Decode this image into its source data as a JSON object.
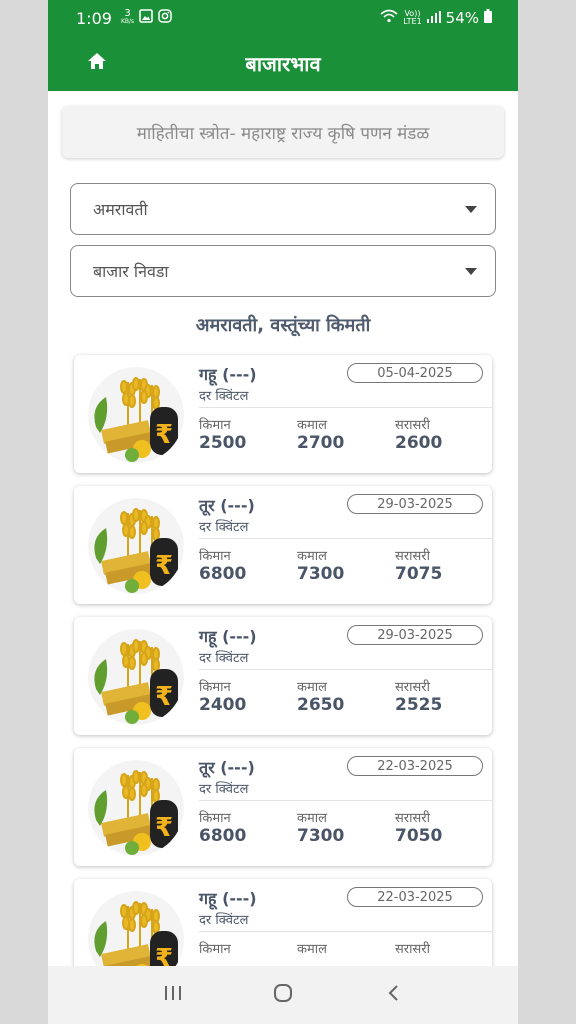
{
  "status": {
    "time": "1:09",
    "speed_value": "3",
    "speed_unit": "KB/s",
    "network": "Vo))",
    "lte": "LTE1",
    "battery": "54%"
  },
  "appbar": {
    "title": "बाजारभाव",
    "home_icon": "home-icon"
  },
  "source": {
    "text": "माहितीचा स्त्रोत- महाराष्ट्र राज्य कृषि पणन मंडळ"
  },
  "district_select": {
    "value": "अमरावती"
  },
  "market_select": {
    "value": "बाजार निवडा"
  },
  "section_title": "अमरावती, वस्तूंच्या किमती",
  "labels": {
    "min": "किमान",
    "max": "कमाल",
    "avg": "सरासरी",
    "rate": "दर क्विंटल"
  },
  "cards": [
    {
      "name": "गहू (---)",
      "unit": "दर क्विंटल",
      "date": "05-04-2025",
      "min_label": "किमान",
      "max_label": "कमाल",
      "avg_label": "सरासरी",
      "min": "2500",
      "max": "2700",
      "avg": "2600"
    },
    {
      "name": "तूर (---)",
      "unit": "दर क्विंटल",
      "date": "29-03-2025",
      "min_label": "किमान",
      "max_label": "कमाल",
      "avg_label": "सरासरी",
      "min": "6800",
      "max": "7300",
      "avg": "7075"
    },
    {
      "name": "गहू (---)",
      "unit": "दर क्विंटल",
      "date": "29-03-2025",
      "min_label": "किमान",
      "max_label": "कमाल",
      "avg_label": "सरासरी",
      "min": "2400",
      "max": "2650",
      "avg": "2525"
    },
    {
      "name": "तूर (---)",
      "unit": "दर क्विंटल",
      "date": "22-03-2025",
      "min_label": "किमान",
      "max_label": "कमाल",
      "avg_label": "सरासरी",
      "min": "6800",
      "max": "7300",
      "avg": "7050"
    },
    {
      "name": "गहू (---)",
      "unit": "दर क्विंटल",
      "date": "22-03-2025",
      "min_label": "किमान",
      "max_label": "कमाल",
      "avg_label": "सरासरी",
      "min": "",
      "max": "",
      "avg": ""
    }
  ],
  "colors": {
    "primary": "#1a9038",
    "text": "#4a5568"
  }
}
